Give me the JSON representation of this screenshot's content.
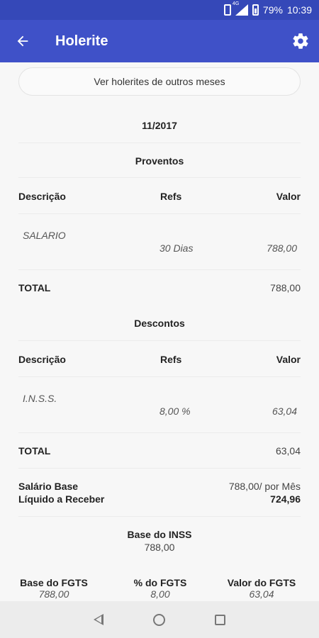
{
  "status_bar": {
    "network": "4G",
    "battery": "79%",
    "time": "10:39"
  },
  "app_bar": {
    "title": "Holerite"
  },
  "months_button": "Ver holerites de outros meses",
  "period": "11/2017",
  "proventos": {
    "section_title": "Proventos",
    "headers": {
      "desc": "Descrição",
      "refs": "Refs",
      "valor": "Valor"
    },
    "items": [
      {
        "desc": "SALARIO",
        "refs": "30 Dias",
        "valor": "788,00"
      }
    ],
    "total_label": "TOTAL",
    "total_value": "788,00"
  },
  "descontos": {
    "section_title": "Descontos",
    "headers": {
      "desc": "Descrição",
      "refs": "Refs",
      "valor": "Valor"
    },
    "items": [
      {
        "desc": "I.N.S.S.",
        "refs": "8,00 %",
        "valor": "63,04"
      }
    ],
    "total_label": "TOTAL",
    "total_value": "63,04"
  },
  "summary": {
    "salario_base_label": "Salário Base",
    "salario_base_value": "788,00/ por Mês",
    "liquido_label": "Líquido a Receber",
    "liquido_value": "724,96"
  },
  "inss": {
    "label": "Base do INSS",
    "value": "788,00"
  },
  "fgts": {
    "base_label": "Base do FGTS",
    "base_value": "788,00",
    "pct_label": "% do FGTS",
    "pct_value": "8,00",
    "valor_label": "Valor do FGTS",
    "valor_value": "63,04"
  }
}
